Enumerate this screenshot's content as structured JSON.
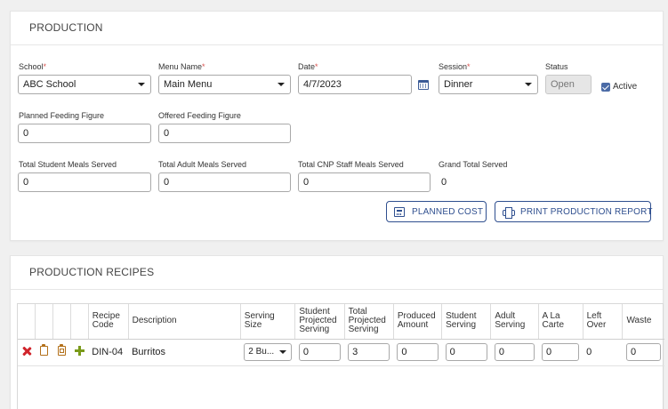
{
  "production": {
    "header": "PRODUCTION",
    "school": {
      "label": "School",
      "value": "ABC School"
    },
    "menu_name": {
      "label": "Menu Name",
      "value": "Main Menu"
    },
    "date": {
      "label": "Date",
      "value": "4/7/2023"
    },
    "session": {
      "label": "Session",
      "value": "Dinner"
    },
    "status": {
      "label": "Status",
      "value": "Open"
    },
    "active": {
      "label": "Active",
      "checked": true
    },
    "required_mark": "*",
    "planned_feeding": {
      "label": "Planned Feeding Figure",
      "value": "0"
    },
    "offered_feeding": {
      "label": "Offered Feeding Figure",
      "value": "0"
    },
    "total_student_meals": {
      "label": "Total Student Meals Served",
      "value": "0"
    },
    "total_adult_meals": {
      "label": "Total Adult Meals Served",
      "value": "0"
    },
    "total_cnp_staff_meals": {
      "label": "Total CNP Staff Meals Served",
      "value": "0"
    },
    "grand_total": {
      "label": "Grand Total Served",
      "value": "0"
    },
    "buttons": {
      "planned_cost": "PLANNED COST",
      "print_report": "PRINT PRODUCTION REPORT"
    },
    "colors": {
      "accent": "#2f4f8f",
      "required": "#d9534f"
    }
  },
  "recipes": {
    "header": "PRODUCTION RECIPES",
    "columns": {
      "recipe_code": "Recipe Code",
      "description": "Description",
      "serving_size": "Serving Size",
      "student_projected": "Student Projected Serving",
      "total_projected": "Total Projected Serving",
      "produced_amount": "Produced Amount",
      "student_serving": "Student Serving",
      "adult_serving": "Adult Serving",
      "a_la_carte": "A La Carte",
      "left_over": "Left Over",
      "waste": "Waste"
    },
    "rows": [
      {
        "recipe_code": "DIN-04",
        "description": "Burritos",
        "serving_size": "2 Bu...",
        "student_projected": "0",
        "total_projected": "3",
        "produced_amount": "0",
        "student_serving": "0",
        "adult_serving": "0",
        "a_la_carte": "0",
        "left_over": "0",
        "waste": "0",
        "icons": [
          "delete-icon",
          "clipboard-icon",
          "clipboard-check-icon",
          "add-icon"
        ]
      }
    ]
  }
}
